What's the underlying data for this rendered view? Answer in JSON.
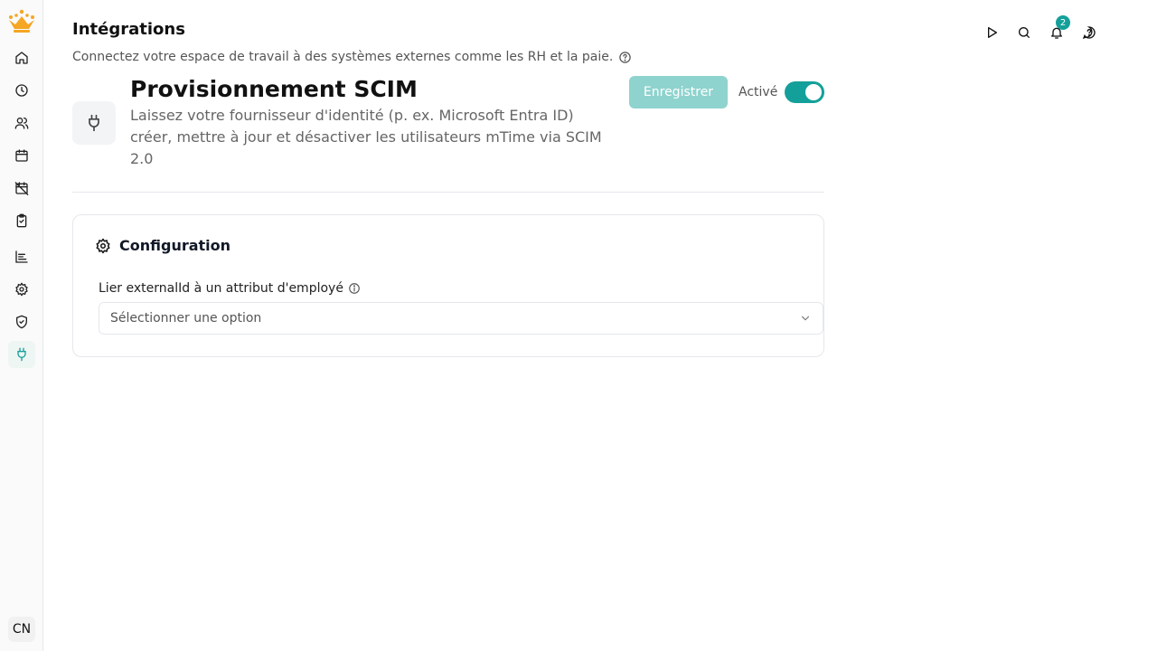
{
  "app": {
    "title": "Intégrations",
    "subtitle": "Connectez votre espace de travail à des systèmes externes comme les RH et la paie.",
    "accent_color": "#14a09a",
    "logo_color": "#f5a623"
  },
  "sidebar": {
    "items": [
      {
        "name": "home",
        "icon": "home-icon"
      },
      {
        "name": "time",
        "icon": "clock-icon"
      },
      {
        "name": "users",
        "icon": "users-icon"
      },
      {
        "name": "calendar",
        "icon": "calendar-icon"
      },
      {
        "name": "absence",
        "icon": "calendar-off-icon"
      },
      {
        "name": "tasks",
        "icon": "clipboard-check-icon"
      },
      {
        "name": "reports",
        "icon": "chart-icon"
      },
      {
        "name": "settings",
        "icon": "gear-icon"
      },
      {
        "name": "security",
        "icon": "shield-check-icon"
      },
      {
        "name": "integrations",
        "icon": "plug-icon",
        "active": true
      }
    ],
    "avatar_initials": "CN"
  },
  "topbar": {
    "notification_count": "2",
    "icons": [
      "play-icon",
      "search-icon",
      "bell-icon",
      "help-chat-icon"
    ]
  },
  "integration": {
    "title": "Provisionnement SCIM",
    "description": "Laissez votre fournisseur d'identité (p. ex. Microsoft Entra ID) créer, mettre à jour et désactiver les utilisateurs mTime via SCIM 2.0",
    "save_label": "Enregistrer",
    "status_label": "Activé",
    "enabled": true
  },
  "configuration": {
    "title": "Configuration",
    "field_label": "Lier externalId à un attribut d'employé",
    "select_placeholder": "Sélectionner une option"
  }
}
